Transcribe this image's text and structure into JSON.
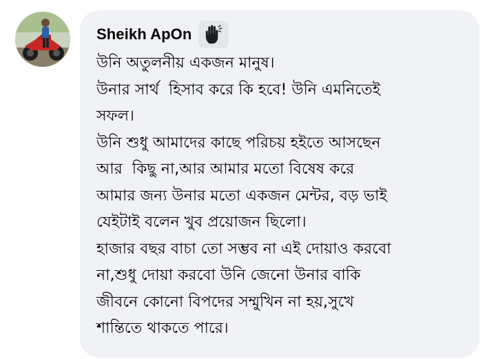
{
  "comment": {
    "author": "Sheikh ApOn",
    "badge_icon": "raised-hand-icon",
    "avatar_icon": "profile-photo-motorbike",
    "bubble_color": "#f0f2f5",
    "text_color": "#050505",
    "lines": [
      "উনি অতুলনীয় একজন মানুষ।",
      "উনার সার্থ  হিসাব করে কি হবে! উনি এমনিতেই",
      "সফল।",
      "উনি শুধু আমাদের কাছে পরিচয় হইতে আসছেন",
      "আর  কিছু না,আর আমার মতো বিষেষ করে",
      "আমার জন্য উনার মতো একজন মেন্টর, বড় ভাই",
      "যেইটাই বলেন খুব প্রয়োজন ছিলো।",
      "হাজার বছর বাচা তো সম্ভব না এই দোয়াও করবো",
      "না,শুধু দোয়া করবো উনি জেনো উনার বাকি",
      "জীবনে কোনো বিপদের সম্মুখিন না হয়,সুখে",
      "শান্তিতে থাকতে পারে।"
    ]
  }
}
